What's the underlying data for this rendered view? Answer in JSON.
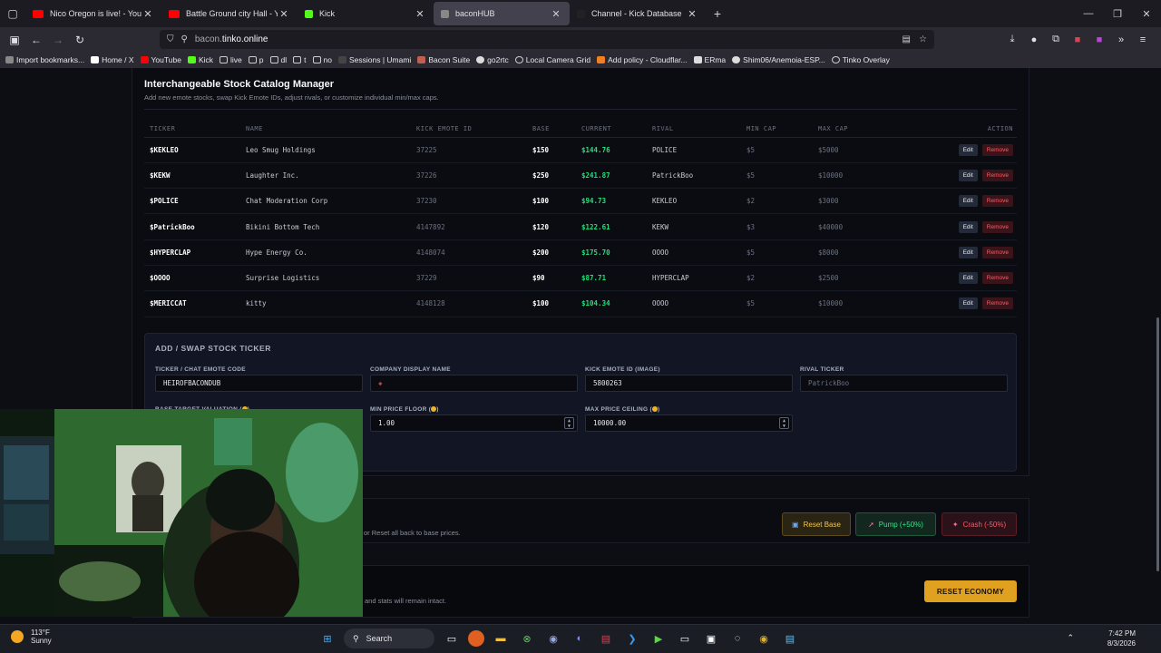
{
  "browser": {
    "tabs": [
      {
        "title": "Nico Oregon is live! - YouTu",
        "favicon_color": "#ff0000",
        "active": false
      },
      {
        "title": "Battle Ground city Hall - Yo",
        "favicon_color": "#ff0000",
        "active": false
      },
      {
        "title": "Kick",
        "favicon_color": "#53fc18",
        "active": false
      },
      {
        "title": "baconHUB",
        "favicon_color": "#888888",
        "active": true
      },
      {
        "title": "Channel - Kick Database",
        "favicon_color": "#222222",
        "active": false
      }
    ],
    "url_prefix": "bacon.",
    "url_host": "tinko.online",
    "bookmarks": [
      "Import bookmarks...",
      "Home / X",
      "YouTube",
      "Kick",
      "live",
      "p",
      "dl",
      "t",
      "no",
      "Sessions | Umami",
      "Bacon Suite",
      "go2rtc",
      "Local Camera Grid",
      "Add policy - Cloudflar...",
      "ERma",
      "Shim06/Anemoia-ESP...",
      "Tinko Overlay"
    ]
  },
  "catalog": {
    "title": "Interchangeable Stock Catalog Manager",
    "subtitle": "Add new emote stocks, swap Kick Emote IDs, adjust rivals, or customize individual min/max caps.",
    "columns": [
      "TICKER",
      "NAME",
      "KICK EMOTE ID",
      "BASE",
      "CURRENT",
      "RIVAL",
      "MIN CAP",
      "MAX CAP",
      "ACTION"
    ],
    "edit_label": "Edit",
    "remove_label": "Remove",
    "rows": [
      {
        "ticker": "$KEKLEO",
        "name": "Leo Smug Holdings",
        "emote_id": "37225",
        "base": "$150",
        "current": "$144.76",
        "rival": "POLICE",
        "min_cap": "$5",
        "max_cap": "$5000"
      },
      {
        "ticker": "$KEKW",
        "name": "Laughter Inc.",
        "emote_id": "37226",
        "base": "$250",
        "current": "$241.87",
        "rival": "PatrickBoo",
        "min_cap": "$5",
        "max_cap": "$10000"
      },
      {
        "ticker": "$POLICE",
        "name": "Chat Moderation Corp",
        "emote_id": "37230",
        "base": "$100",
        "current": "$94.73",
        "rival": "KEKLEO",
        "min_cap": "$2",
        "max_cap": "$3000"
      },
      {
        "ticker": "$PatrickBoo",
        "name": "Bikini Bottom Tech",
        "emote_id": "4147892",
        "base": "$120",
        "current": "$122.61",
        "rival": "KEKW",
        "min_cap": "$3",
        "max_cap": "$40000"
      },
      {
        "ticker": "$HYPERCLAP",
        "name": "Hype Energy Co.",
        "emote_id": "4148074",
        "base": "$200",
        "current": "$175.70",
        "rival": "OOOO",
        "min_cap": "$5",
        "max_cap": "$8000"
      },
      {
        "ticker": "$OOOO",
        "name": "Surprise Logistics",
        "emote_id": "37229",
        "base": "$90",
        "current": "$87.71",
        "rival": "HYPERCLAP",
        "min_cap": "$2",
        "max_cap": "$2500"
      },
      {
        "ticker": "$MERICCAT",
        "name": "kitty",
        "emote_id": "4148128",
        "base": "$100",
        "current": "$104.34",
        "rival": "OOOO",
        "min_cap": "$5",
        "max_cap": "$10000"
      }
    ]
  },
  "form": {
    "title": "ADD / SWAP STOCK TICKER",
    "ticker_label": "TICKER / CHAT EMOTE CODE",
    "ticker_value": "HEIROFBACONDUB",
    "company_label": "COMPANY DISPLAY NAME",
    "company_value": "",
    "emote_id_label": "KICK EMOTE ID (IMAGE)",
    "emote_id_value": "5800263",
    "rival_label": "RIVAL TICKER",
    "rival_placeholder": "PatrickBoo",
    "base_label": "BASE TARGET VALUATION (",
    "min_label": "MIN PRICE FLOOR (",
    "min_value": "1.00",
    "max_label": "MAX PRICE CEILING (",
    "max_value": "10000.00",
    "label_close": ")"
  },
  "controls": {
    "text": "or Reset all back to base prices.",
    "reset_base": "Reset Base",
    "pump": "Pump (+50%)",
    "crash": "Crash (-50%)"
  },
  "danger": {
    "text": "and stats will remain intact.",
    "button": "RESET ECONOMY"
  },
  "taskbar": {
    "temp": "113°F",
    "condition": "Sunny",
    "search": "Search",
    "time": "7:42 PM",
    "date": "8/3/2026"
  }
}
